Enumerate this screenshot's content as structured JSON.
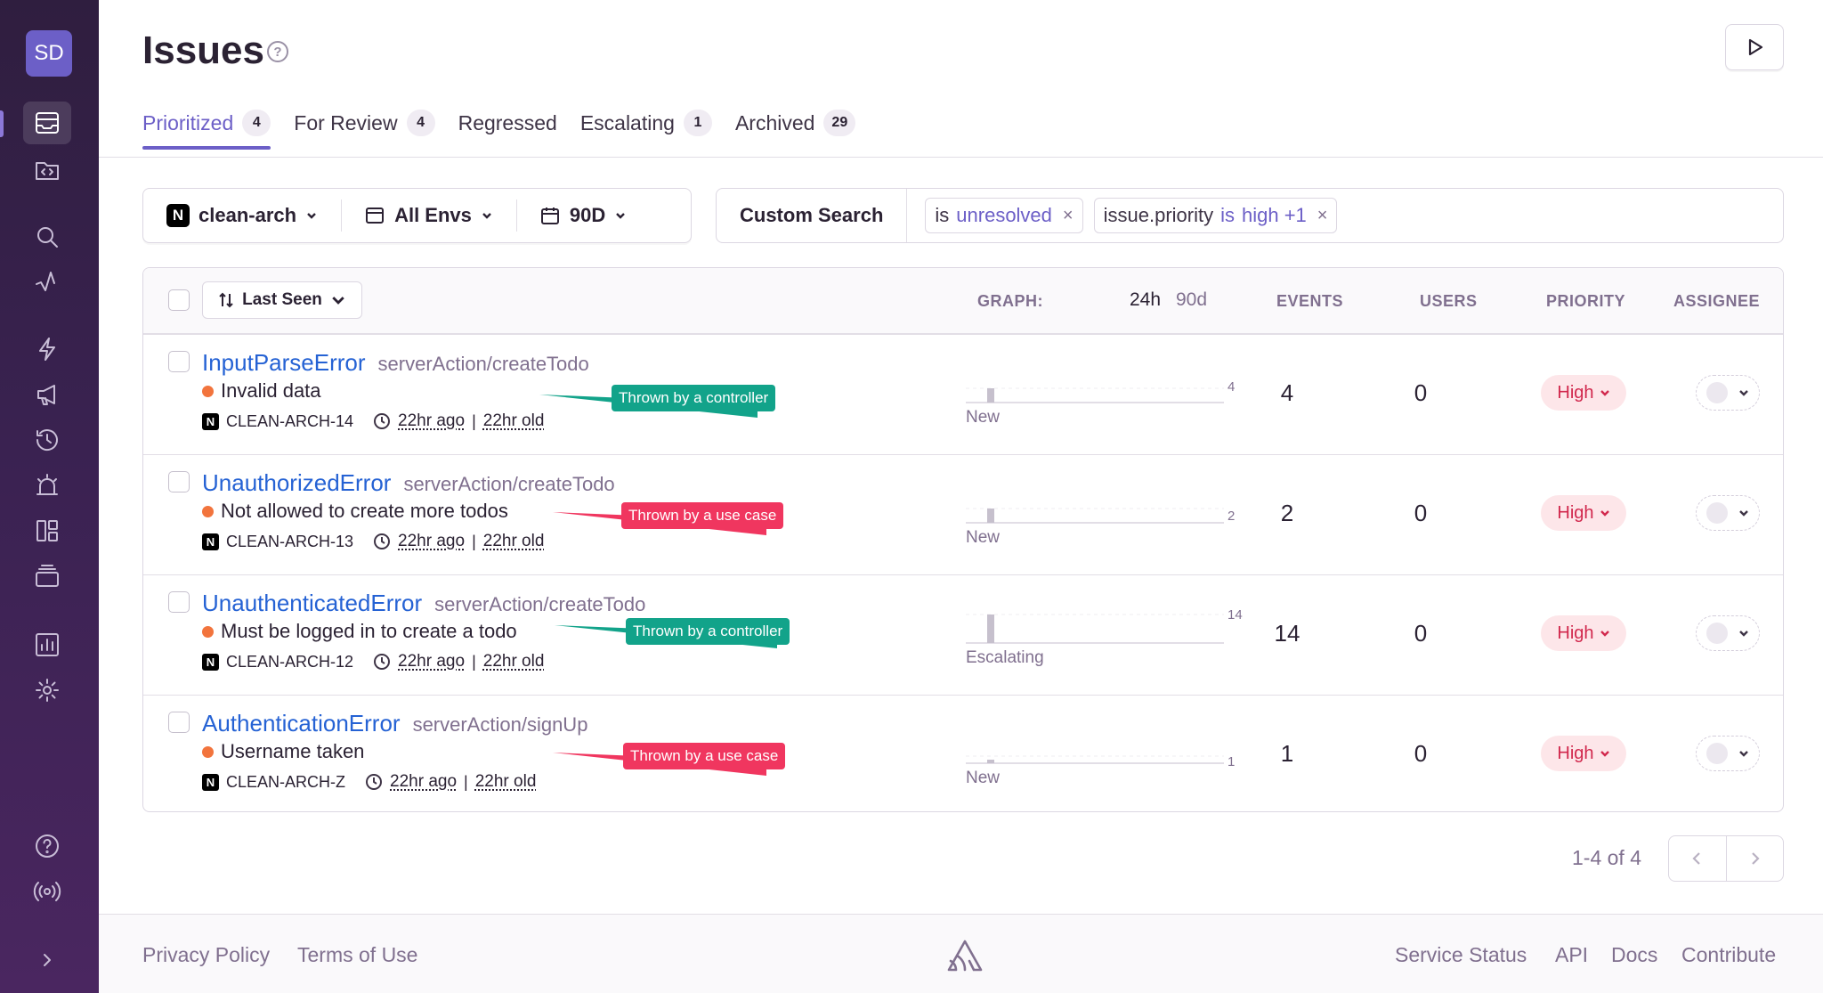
{
  "org": {
    "initials": "SD"
  },
  "header": {
    "title": "Issues"
  },
  "tabs": [
    {
      "label": "Prioritized",
      "count": "4"
    },
    {
      "label": "For Review",
      "count": "4"
    },
    {
      "label": "Regressed",
      "count": ""
    },
    {
      "label": "Escalating",
      "count": "1"
    },
    {
      "label": "Archived",
      "count": "29"
    }
  ],
  "filters": {
    "project": "clean-arch",
    "environment": "All Envs",
    "period": "90D",
    "custom_search": "Custom Search",
    "tokens": [
      {
        "key": "is",
        "op": "",
        "value": "unresolved"
      },
      {
        "key": "issue.priority",
        "op": "is",
        "value": "high +1"
      }
    ]
  },
  "table": {
    "sort_label": "Last Seen",
    "columns": {
      "graph": "GRAPH:",
      "graph_24h": "24h",
      "graph_90d": "90d",
      "events": "EVENTS",
      "users": "USERS",
      "priority": "PRIORITY",
      "assignee": "ASSIGNEE"
    },
    "rows": [
      {
        "title": "InputParseError",
        "culprit": "serverAction/createTodo",
        "message": "Invalid data",
        "short_id": "CLEAN-ARCH-14",
        "last_seen": "22hr ago",
        "first_seen": "22hr old",
        "annotation": "Thrown by a controller",
        "annotation_type": "ctrl",
        "graph_max": "4",
        "graph_value": 4,
        "graph_status": "New",
        "events": "4",
        "users": "0",
        "priority": "High"
      },
      {
        "title": "UnauthorizedError",
        "culprit": "serverAction/createTodo",
        "message": "Not allowed to create more todos",
        "short_id": "CLEAN-ARCH-13",
        "last_seen": "22hr ago",
        "first_seen": "22hr old",
        "annotation": "Thrown by a use case",
        "annotation_type": "uc",
        "graph_max": "2",
        "graph_value": 2,
        "graph_status": "New",
        "events": "2",
        "users": "0",
        "priority": "High"
      },
      {
        "title": "UnauthenticatedError",
        "culprit": "serverAction/createTodo",
        "message": "Must be logged in to create a todo",
        "short_id": "CLEAN-ARCH-12",
        "last_seen": "22hr ago",
        "first_seen": "22hr old",
        "annotation": "Thrown by a controller",
        "annotation_type": "ctrl",
        "graph_max": "14",
        "graph_value": 14,
        "graph_status": "Escalating",
        "events": "14",
        "users": "0",
        "priority": "High"
      },
      {
        "title": "AuthenticationError",
        "culprit": "serverAction/signUp",
        "message": "Username taken",
        "short_id": "CLEAN-ARCH-Z",
        "last_seen": "22hr ago",
        "first_seen": "22hr old",
        "annotation": "Thrown by a use case",
        "annotation_type": "uc",
        "graph_max": "1",
        "graph_value": 1,
        "graph_status": "New",
        "events": "1",
        "users": "0",
        "priority": "High"
      }
    ]
  },
  "pagination": {
    "label": "1-4 of 4"
  },
  "footer": {
    "left": [
      "Privacy Policy",
      "Terms of Use"
    ],
    "right": [
      "Service Status",
      "API",
      "Docs",
      "Contribute"
    ]
  },
  "colors": {
    "accent": "#6c5fc7",
    "controller": "#12a38a",
    "use_case": "#f0365f",
    "priority_high": "#d1284d"
  }
}
